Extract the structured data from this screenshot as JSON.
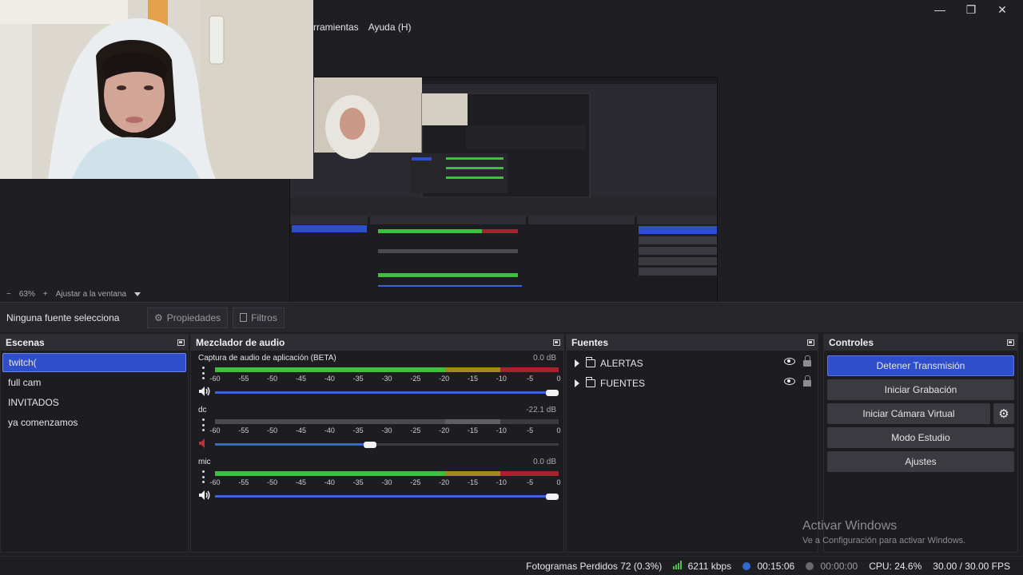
{
  "window": {
    "minimize": "—",
    "restore": "❐",
    "close": "✕"
  },
  "menu": {
    "items": [
      "rramientas",
      "Ayuda (H)"
    ]
  },
  "zoom": {
    "minus": "−",
    "level": "63%",
    "plus": "+",
    "fit_label": "Ajustar a la ventana"
  },
  "source_toolbar": {
    "no_source": "Ninguna fuente selecciona",
    "properties": "Propiedades",
    "filters": "Filtros"
  },
  "scenes": {
    "title": "Escenas",
    "items": [
      "twitch(",
      "full cam",
      "INVITADOS",
      "ya comenzamos"
    ],
    "selected_index": 0
  },
  "mixer": {
    "title": "Mezclador de audio",
    "scale": [
      "-60",
      "-55",
      "-50",
      "-45",
      "-40",
      "-35",
      "-30",
      "-25",
      "-20",
      "-15",
      "-10",
      "-5",
      "0"
    ],
    "channels": [
      {
        "name": "Captura de audio de aplicación (BETA)",
        "db": "0.0 dB",
        "muted": false,
        "volume_fraction": 1.0
      },
      {
        "name": "dc",
        "db": "-22.1 dB",
        "muted": true,
        "volume_fraction": 0.45
      },
      {
        "name": "mic",
        "db": "0.0 dB",
        "muted": false,
        "volume_fraction": 1.0
      }
    ]
  },
  "sources": {
    "title": "Fuentes",
    "items": [
      {
        "label": "ALERTAS"
      },
      {
        "label": "FUENTES"
      }
    ]
  },
  "controls": {
    "title": "Controles",
    "stop_stream": "Detener Transmisión",
    "start_recording": "Iniciar Grabación",
    "start_virtual_cam": "Iniciar Cámara Virtual",
    "studio_mode": "Modo Estudio",
    "settings": "Ajustes"
  },
  "watermark": {
    "title": "Activar Windows",
    "subtitle": "Ve a Configuración para activar Windows."
  },
  "status": {
    "dropped_frames": "Fotogramas Perdidos 72 (0.3%)",
    "bitrate": "6211 kbps",
    "stream_time": "00:15:06",
    "rec_time": "00:00:00",
    "cpu": "CPU: 24.6%",
    "fps": "30.00 / 30.00 FPS"
  },
  "colors": {
    "accent": "#2f4ecc",
    "meter_green": "#3cc13c",
    "meter_yellow": "#a38a1c",
    "meter_red": "#a8222e",
    "live_dot": "#2f6ad0",
    "rec_dot": "#6a6a6a"
  }
}
